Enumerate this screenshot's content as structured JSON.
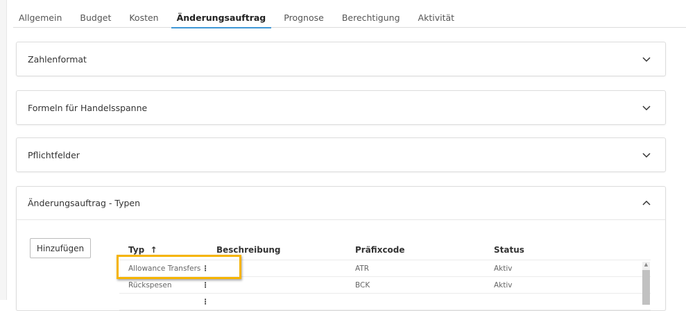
{
  "tabs": [
    "Allgemein",
    "Budget",
    "Kosten",
    "Änderungsauftrag",
    "Prognose",
    "Berechtigung",
    "Aktivität"
  ],
  "active_tab": "Änderungsauftrag",
  "panels": [
    "Zahlenformat",
    "Formeln für Handelsspanne",
    "Pflichtfelder",
    "Änderungsauftrag - Typen"
  ],
  "add_button": "Hinzufügen",
  "table": {
    "headers": {
      "typ": "Typ",
      "sort": "↑",
      "beschreibung": "Beschreibung",
      "praefix": "Präfixcode",
      "status": "Status"
    },
    "rows": [
      {
        "typ": "Allowance Transfers",
        "beschreibung": "",
        "praefix": "ATR",
        "status": "Aktiv"
      },
      {
        "typ": "Rückspesen",
        "beschreibung": "",
        "praefix": "BCK",
        "status": "Aktiv"
      }
    ]
  },
  "highlight_color": "#f6b400"
}
